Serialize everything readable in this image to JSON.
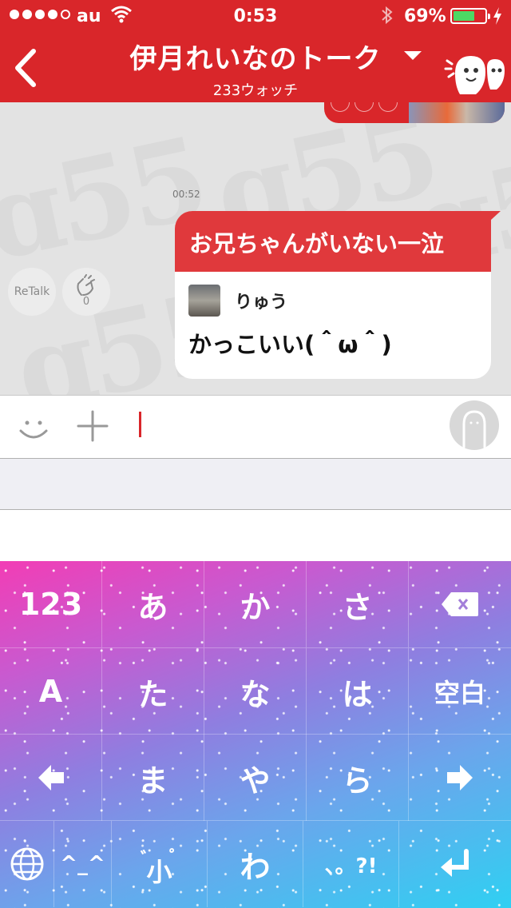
{
  "status_bar": {
    "carrier": "au",
    "time": "0:53",
    "battery_percent": "69%",
    "battery_level": 0.69,
    "signal_dots_filled": 4
  },
  "header": {
    "back_icon": "chevron-left-icon",
    "title": "伊月れいなのトーク",
    "subtitle": "233ウォッチ",
    "dropdown_icon": "caret-down-icon",
    "mascot_icon": "ghost-mascot-icon",
    "color": "#d9262a"
  },
  "chat": {
    "timestamp": "00:52",
    "message": {
      "headline": "お兄ちゃんがいない一泣",
      "user_name": "りゅう",
      "body": "かっこいい(＾ω＾)"
    },
    "retalk_label": "ReTalk",
    "clap_count": "0"
  },
  "input": {
    "value": "",
    "smiley_icon": "smiley-icon",
    "plus_icon": "plus-icon",
    "profile_icon": "profile-silhouette-icon"
  },
  "keyboard": {
    "rows": [
      [
        "123",
        "あ",
        "か",
        "さ",
        "⌫"
      ],
      [
        "A",
        "た",
        "な",
        "は",
        "空白"
      ],
      [
        "◀",
        "ま",
        "や",
        "ら",
        "▶"
      ],
      [
        "🌐",
        "^_^",
        "゛゜小",
        "わ",
        "、。?!",
        "↵"
      ]
    ],
    "row1": {
      "k0": "123",
      "k1": "あ",
      "k2": "か",
      "k3": "さ"
    },
    "row2": {
      "k0": "A",
      "k1": "た",
      "k2": "な",
      "k3": "は",
      "k4": "空白"
    },
    "row3": {
      "k1": "ま",
      "k2": "や",
      "k3": "ら"
    },
    "row4": {
      "k1": "^_^",
      "k2": "小",
      "k3": "わ",
      "k4": "、。?!"
    }
  }
}
